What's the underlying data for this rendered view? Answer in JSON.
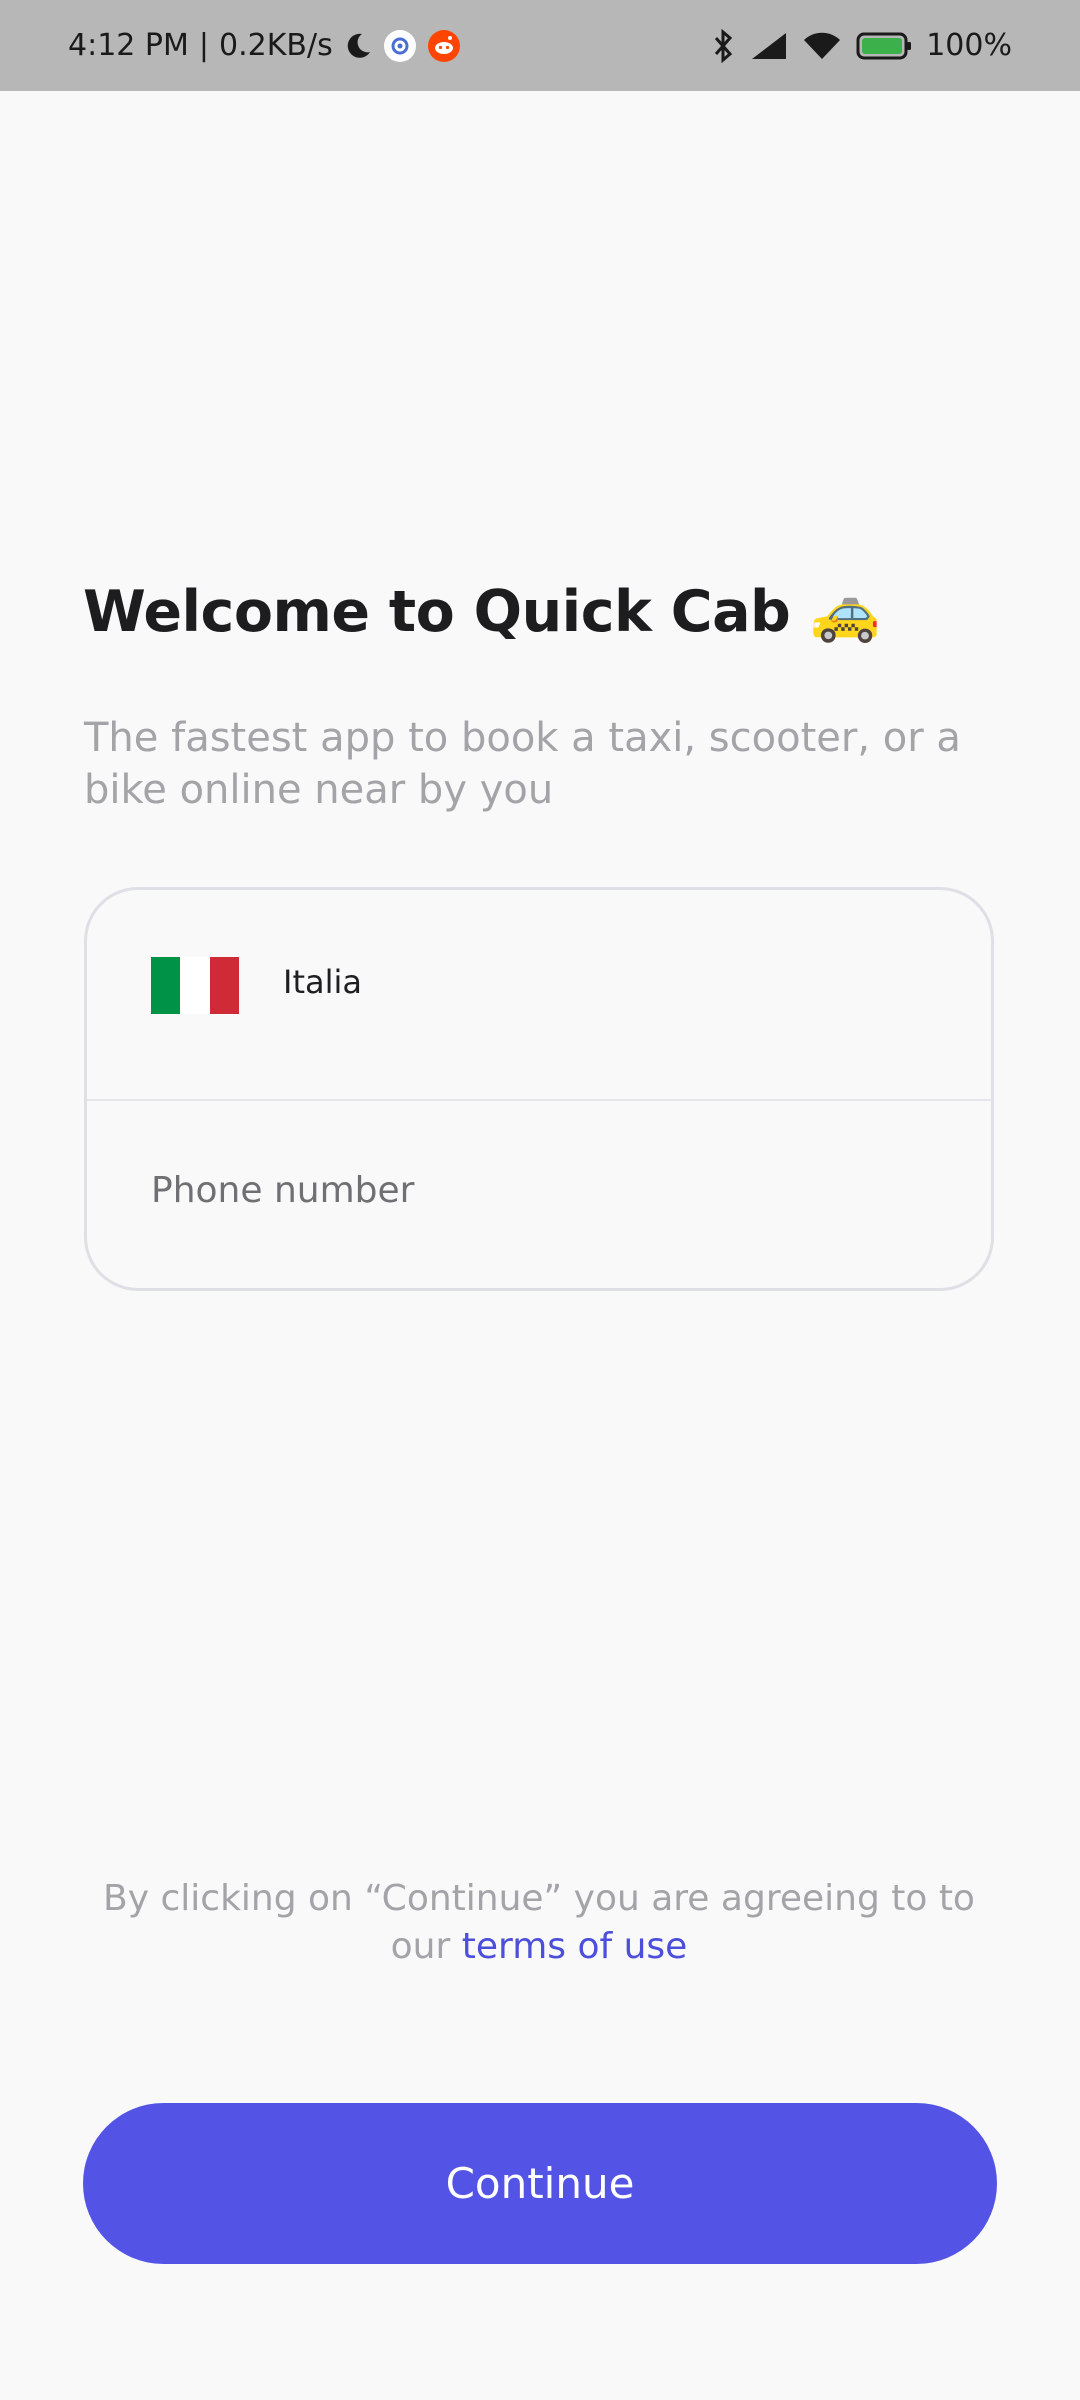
{
  "status_bar": {
    "time": "4:12 PM",
    "separator": "|",
    "network_speed": "0.2KB/s",
    "battery": "100%",
    "icons": [
      "moon-icon",
      "gear-app-icon",
      "reddit-icon",
      "bluetooth-icon",
      "signal-icon",
      "wifi-icon",
      "battery-icon"
    ]
  },
  "welcome": {
    "title": "Welcome to Quick Cab",
    "emoji": "🚕",
    "subtitle": "The fastest app to book a taxi, scooter, or a bike online near by you"
  },
  "form": {
    "country_name": "Italia",
    "flag_colors": [
      "#009246",
      "#ffffff",
      "#ce2b37"
    ],
    "phone_placeholder": "Phone number"
  },
  "terms": {
    "prefix": "By clicking on “Continue” you are agreeing to to our",
    "link_text": "terms of use"
  },
  "actions": {
    "continue_label": "Continue"
  },
  "colors": {
    "accent": "#5354e6",
    "link": "#4c4fd9",
    "background": "#f9f9fa"
  }
}
